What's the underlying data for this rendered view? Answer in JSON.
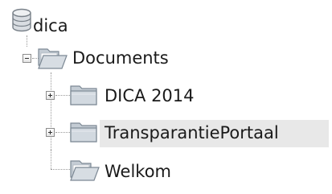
{
  "tree": {
    "root": {
      "label": "dica",
      "icon": "database-icon"
    },
    "documents": {
      "label": "Documents",
      "icon": "folder-open-icon",
      "state": "expanded"
    },
    "children": [
      {
        "label": "DICA 2014",
        "icon": "folder-icon",
        "state": "collapsed"
      },
      {
        "label": "TransparantiePortaal",
        "icon": "folder-icon",
        "state": "collapsed",
        "highlighted": true
      },
      {
        "label": "Welkom",
        "icon": "folder-open-icon"
      }
    ]
  },
  "colors": {
    "highlight": "#e8e8e8",
    "folder_body": "#c4ccd4",
    "folder_edge": "#7c8894"
  }
}
